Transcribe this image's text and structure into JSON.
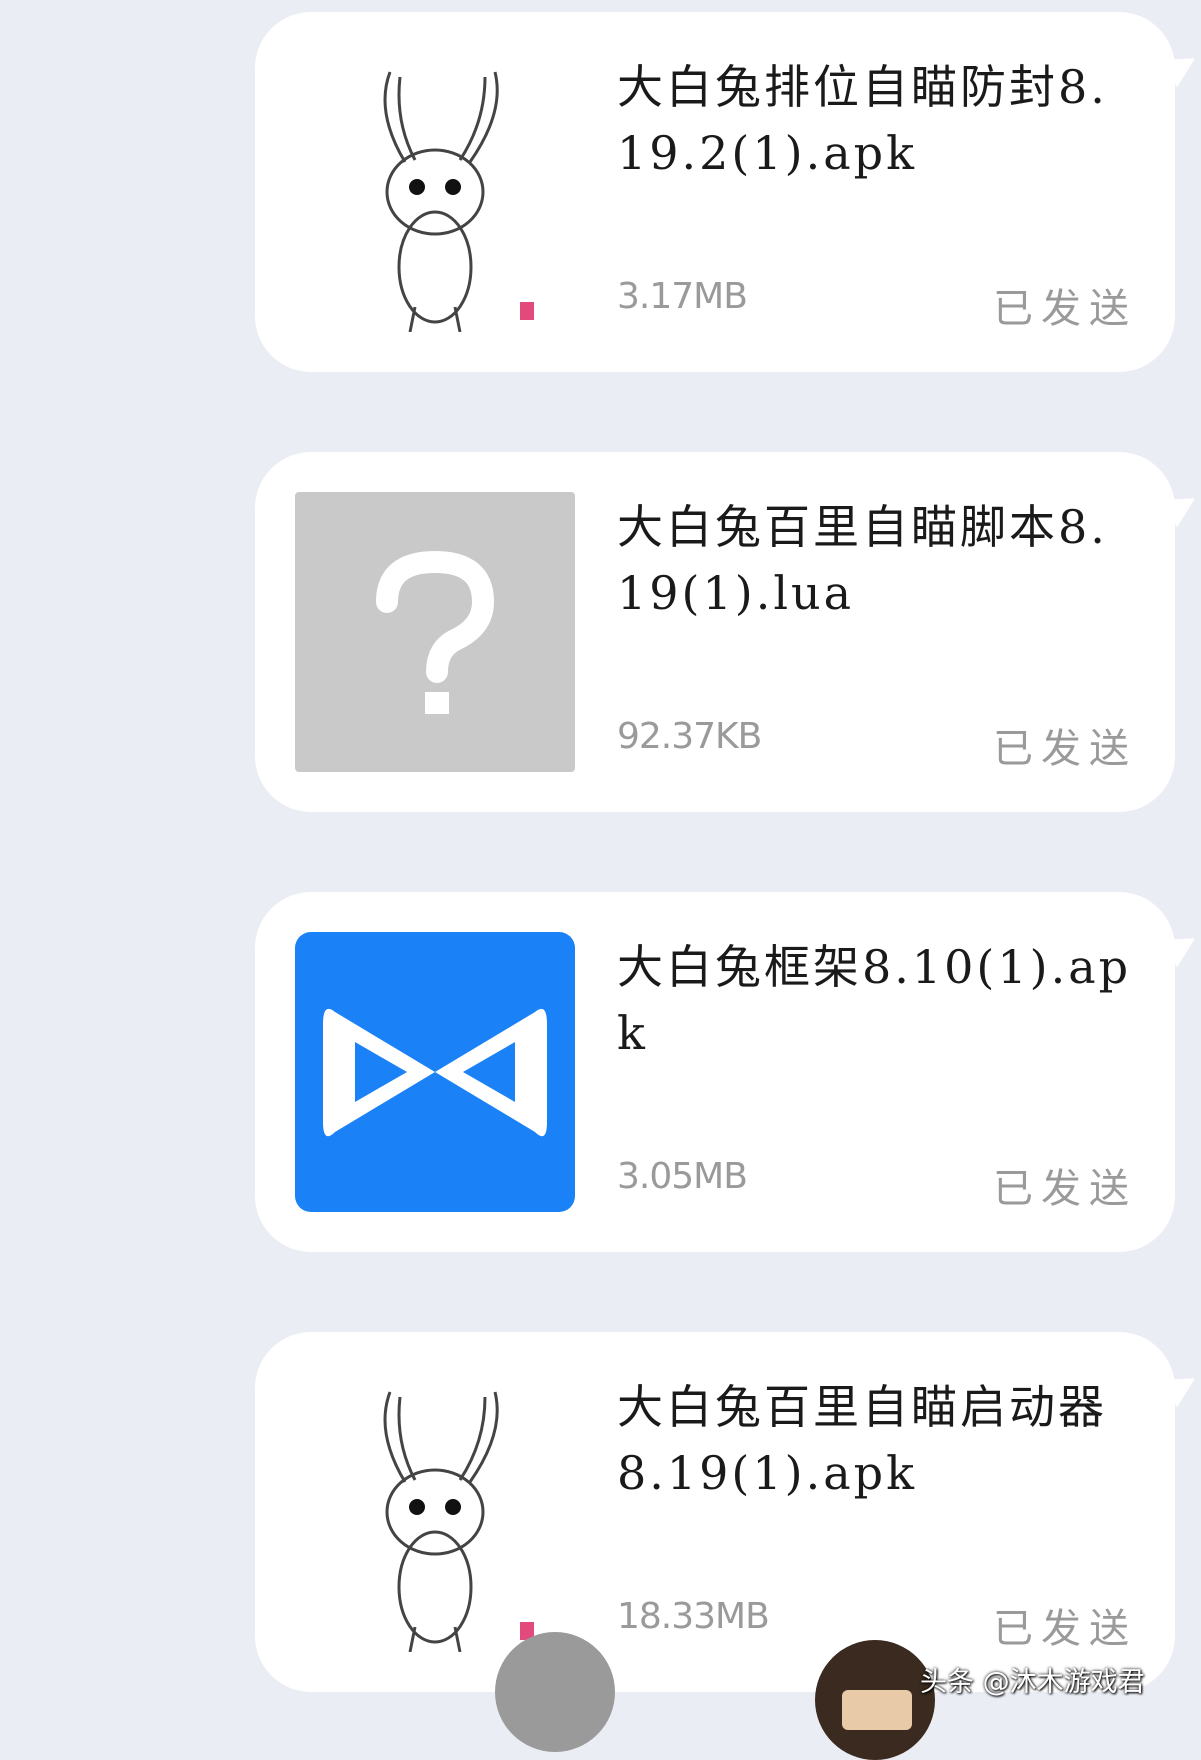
{
  "messages": [
    {
      "file_name": "大白兔排位自瞄防封8.19.2(1).apk",
      "size": "3.17MB",
      "status": "已发送",
      "thumb": "rabbit-sketch"
    },
    {
      "file_name": "大白兔百里自瞄脚本8.19(1).lua",
      "size": "92.37KB",
      "status": "已发送",
      "thumb": "unknown-file"
    },
    {
      "file_name": "大白兔框架8.10(1).apk",
      "size": "3.05MB",
      "status": "已发送",
      "thumb": "blue-bowtie-app"
    },
    {
      "file_name": "大白兔百里自瞄启动器8.19(1).apk",
      "size": "18.33MB",
      "status": "已发送",
      "thumb": "rabbit-sketch"
    }
  ],
  "watermark": "头条 @沐木游戏君",
  "colors": {
    "background": "#ebedf5",
    "bubble": "#ffffff",
    "app_icon": "#1a82f6",
    "unknown_icon": "#c9c9c9",
    "meta_text": "#9a9a9a"
  }
}
